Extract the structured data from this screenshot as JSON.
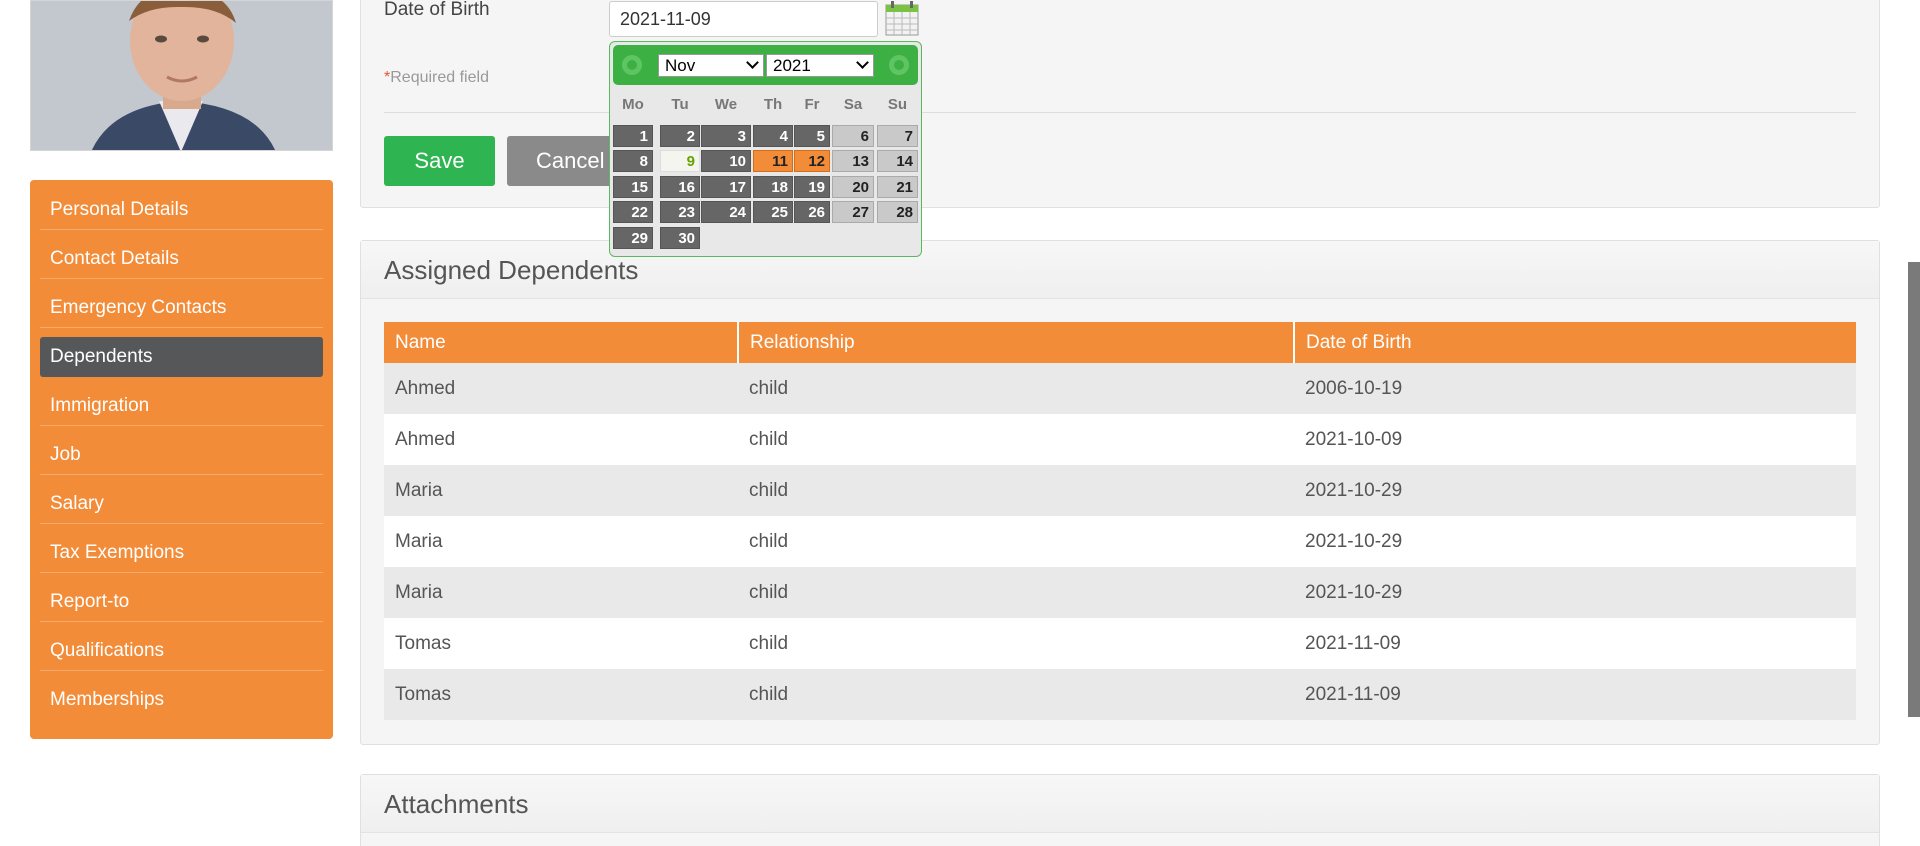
{
  "sidebar": {
    "items": [
      {
        "label": "Personal Details"
      },
      {
        "label": "Contact Details"
      },
      {
        "label": "Emergency Contacts"
      },
      {
        "label": "Dependents",
        "active": true
      },
      {
        "label": "Immigration"
      },
      {
        "label": "Job"
      },
      {
        "label": "Salary"
      },
      {
        "label": "Tax Exemptions"
      },
      {
        "label": "Report-to"
      },
      {
        "label": "Qualifications"
      },
      {
        "label": "Memberships"
      }
    ]
  },
  "form": {
    "dob_label": "Date of Birth",
    "dob_value": "2021-11-09",
    "required_mark": "*",
    "required_text": "Required field",
    "save_label": "Save",
    "cancel_label": "Cancel"
  },
  "datepicker": {
    "month": "Nov",
    "year": "2021",
    "weekdays": [
      "Mo",
      "Tu",
      "We",
      "Th",
      "Fr",
      "Sa",
      "Su"
    ],
    "first_weekday_index": 0,
    "days_in_month": 30,
    "today": 9,
    "highlighted": [
      11,
      12
    ]
  },
  "dependents": {
    "title": "Assigned Dependents",
    "columns": [
      "Name",
      "Relationship",
      "Date of Birth"
    ],
    "rows": [
      [
        "Ahmed",
        "child",
        "2006-10-19"
      ],
      [
        "Ahmed",
        "child",
        "2021-10-09"
      ],
      [
        "Maria",
        "child",
        "2021-10-29"
      ],
      [
        "Maria",
        "child",
        "2021-10-29"
      ],
      [
        "Maria",
        "child",
        "2021-10-29"
      ],
      [
        "Tomas",
        "child",
        "2021-11-09"
      ],
      [
        "Tomas",
        "child",
        "2021-11-09"
      ]
    ]
  },
  "attachments": {
    "title": "Attachments"
  },
  "colors": {
    "accent_orange": "#f28c38",
    "save_green": "#2eb450",
    "datepicker_green": "#3cb043",
    "active_nav": "#555759"
  }
}
